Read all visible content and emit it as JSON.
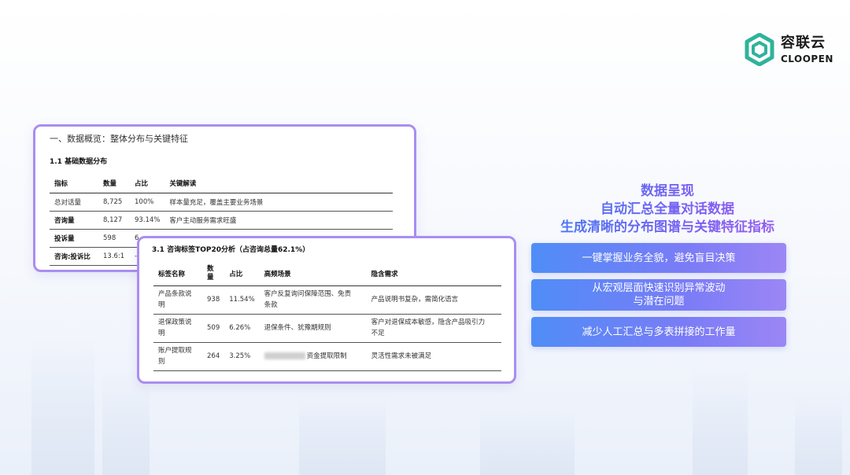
{
  "brand": {
    "name_cn": "容联云",
    "name_en": "CLOOPEN",
    "accent": "#2fb39a"
  },
  "back_card": {
    "section_title": "一、数据概览：整体分布与关键特征",
    "subtitle": "1.1 基础数据分布",
    "headers": [
      "指标",
      "数量",
      "占比",
      "关键解读"
    ],
    "rows": [
      [
        "总对话量",
        "8,725",
        "100%",
        "样本量充足，覆盖主要业务场景"
      ],
      [
        "咨询量",
        "8,127",
        "93.14%",
        "客户主动服务需求旺盛"
      ],
      [
        "投诉量",
        "598",
        "6",
        ""
      ],
      [
        "咨询:投诉比",
        "13.6:1",
        "-",
        ""
      ]
    ]
  },
  "front_card": {
    "subtitle": "3.1 咨询标签TOP20分析（占咨询总量62.1%）",
    "headers": [
      "标签名称",
      "数量",
      "占比",
      "高频场景",
      "隐含需求"
    ],
    "headers_qty": [
      "数",
      "量"
    ],
    "rows": [
      {
        "name": [
          "产品条款说",
          "明"
        ],
        "qty": "938",
        "pct": "11.54%",
        "scene": [
          "客户反复询问保障范围、免责",
          "条款"
        ],
        "need": [
          "产品说明书复杂，需简化语言",
          ""
        ]
      },
      {
        "name": [
          "退保政策说",
          "明"
        ],
        "qty": "509",
        "pct": "6.26%",
        "scene": [
          "退保条件、犹豫期规则",
          ""
        ],
        "need": [
          "客户对退保成本敏感，隐含产品吸引力",
          "不足"
        ]
      },
      {
        "name": [
          "账户提取规",
          "则"
        ],
        "qty": "264",
        "pct": "3.25%",
        "scene": [
          "资金提取限制",
          ""
        ],
        "need": [
          "灵活性需求未被满足",
          ""
        ]
      }
    ]
  },
  "headline": {
    "line1": "数据呈现",
    "line2": "自动汇总全量对话数据",
    "line3": "生成清晰的分布图谱与关键特征指标"
  },
  "pills": {
    "p1": "一键掌握业务全貌，避免盲目决策",
    "p2_line1": "从宏观层面快速识别异常波动",
    "p2_line2": "与潜在问题",
    "p3": "减少人工汇总与多表拼接的工作量"
  }
}
